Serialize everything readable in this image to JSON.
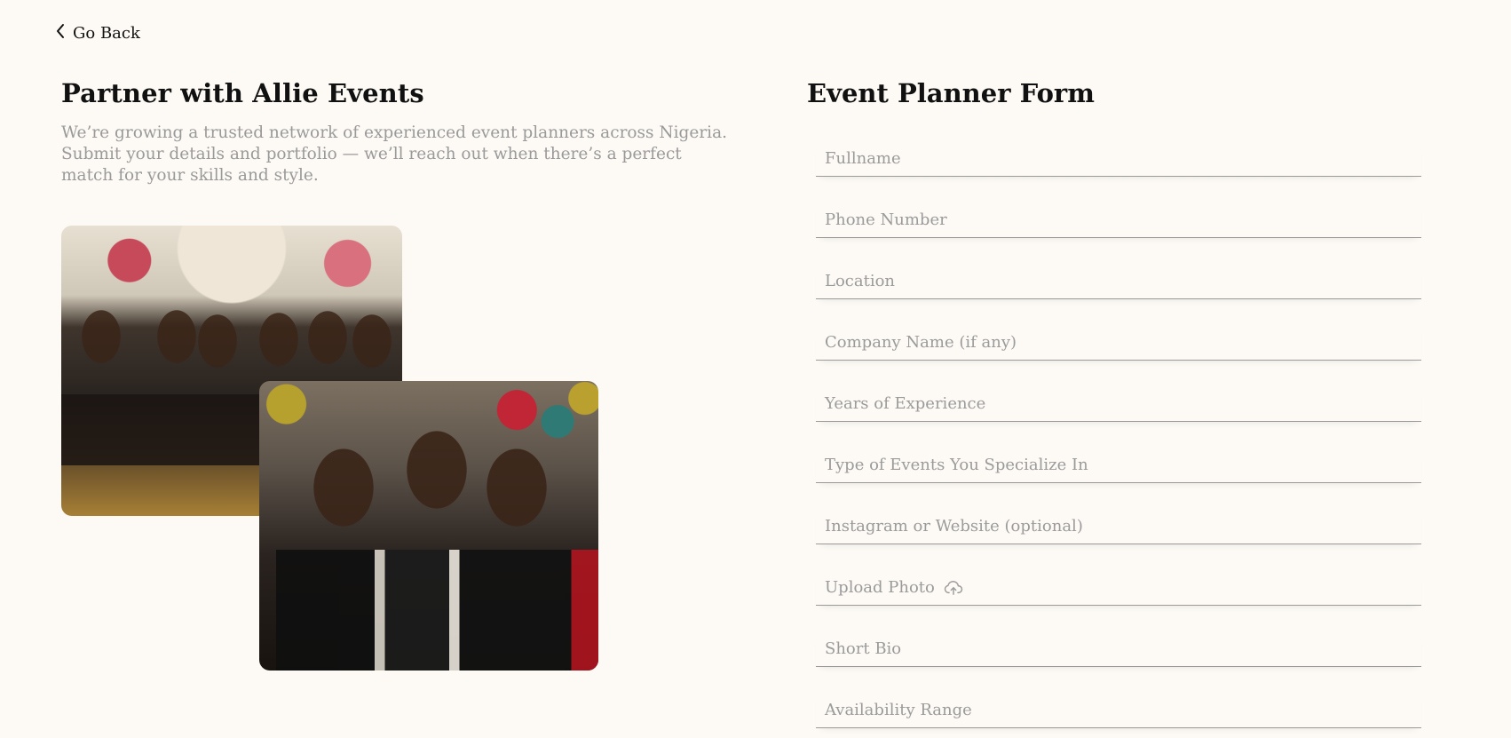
{
  "nav": {
    "back_label": "Go Back",
    "back_icon": "chevron-left-icon"
  },
  "left": {
    "title": "Partner with Allie Events",
    "intro": "We’re growing a trusted network of experienced event planners across Nigeria. Submit your details and portfolio — we’ll reach out when there’s a perfect match for your skills and style."
  },
  "form": {
    "title": "Event Planner Form",
    "fields": [
      {
        "placeholder": "Fullname"
      },
      {
        "placeholder": "Phone Number"
      },
      {
        "placeholder": "Location"
      },
      {
        "placeholder": "Company Name (if any)"
      },
      {
        "placeholder": "Years of Experience"
      },
      {
        "placeholder": "Type of Events You Specialize In"
      },
      {
        "placeholder": "Instagram or Website (optional)"
      },
      {
        "placeholder": "Upload Photo",
        "icon": "cloud-upload-icon"
      },
      {
        "placeholder": "Short Bio"
      },
      {
        "placeholder": "Availability Range"
      }
    ]
  },
  "colors": {
    "background": "#fdfaf5",
    "text": "#111111",
    "muted": "#9a9a9a",
    "divider": "#9a9a9a"
  }
}
